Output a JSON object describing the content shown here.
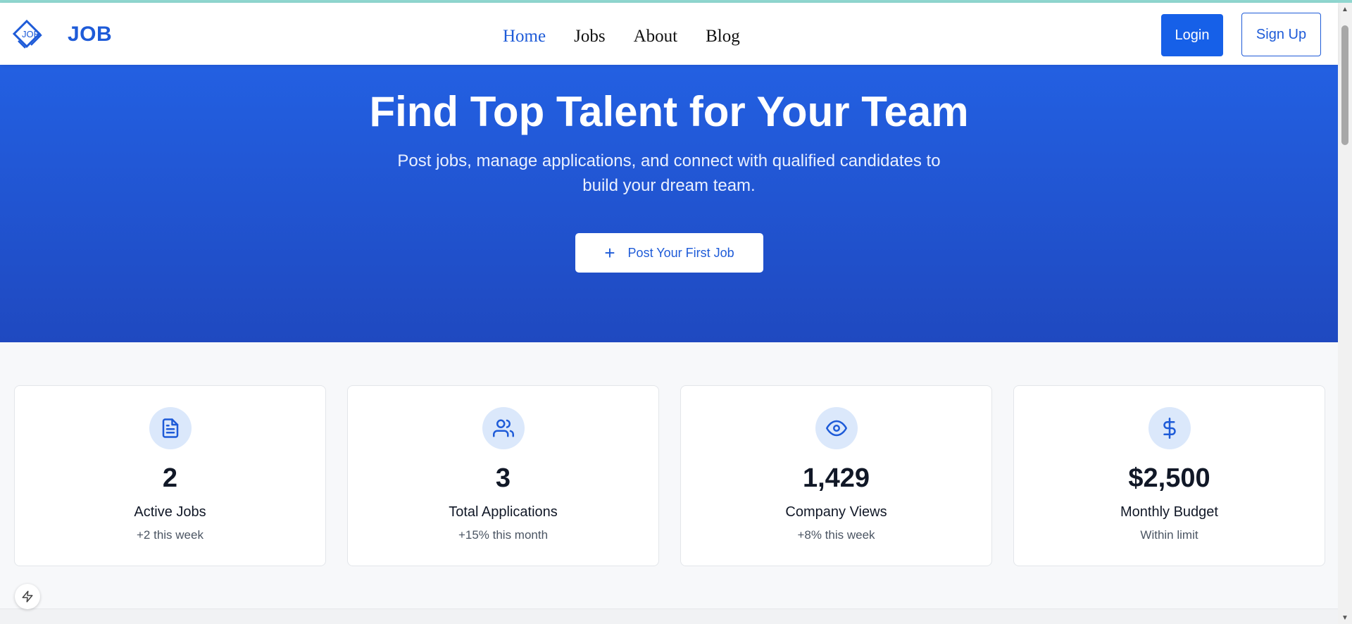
{
  "brand": {
    "name": "JOB",
    "logo_icon": "job-diamond-logo",
    "logo_text": "JOB"
  },
  "nav": {
    "links": [
      {
        "label": "Home",
        "active": true
      },
      {
        "label": "Jobs",
        "active": false
      },
      {
        "label": "About",
        "active": false
      },
      {
        "label": "Blog",
        "active": false
      }
    ],
    "login_label": "Login",
    "signup_label": "Sign Up"
  },
  "hero": {
    "title": "Find Top Talent for Your Team",
    "subtitle": "Post jobs, manage applications, and connect with qualified candidates to build your dream team.",
    "cta_label": "Post Your First Job",
    "cta_icon": "plus-icon"
  },
  "stats": [
    {
      "icon": "file-text-icon",
      "value": "2",
      "label": "Active Jobs",
      "sub": "+2 this week"
    },
    {
      "icon": "users-icon",
      "value": "3",
      "label": "Total Applications",
      "sub": "+15% this month"
    },
    {
      "icon": "eye-icon",
      "value": "1,429",
      "label": "Company Views",
      "sub": "+8% this week"
    },
    {
      "icon": "dollar-icon",
      "value": "$2,500",
      "label": "Monthly Budget",
      "sub": "Within limit"
    }
  ],
  "floating_button_icon": "lightning-icon",
  "colors": {
    "brand_blue": "#1e5bd8",
    "button_blue": "#1660e8",
    "hero_gradient_top": "#2360e2",
    "hero_gradient_bottom": "#1f49c0",
    "icon_circle_bg": "#dbe8fb"
  }
}
